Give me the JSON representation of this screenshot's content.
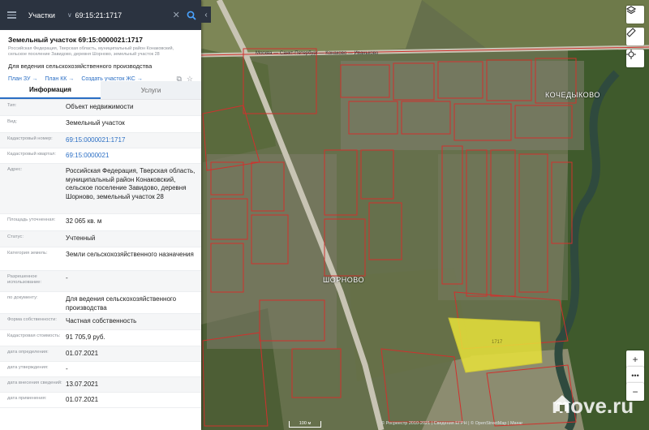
{
  "search": {
    "type_label": "Участки",
    "value": "69:15:21:1717"
  },
  "object": {
    "title": "Земельный участок 69:15:0000021:1717",
    "address_line": "Российская Федерация, Тверская область, муниципальный район Конаковский, сельское поселение Завидово, деревня Шорново, земельный участок 28",
    "purpose": "Для ведения сельскохозяйственного производства"
  },
  "links": {
    "plan_zu": "План ЗУ",
    "plan_kk": "План КК",
    "create_zhs": "Создать участок ЖС"
  },
  "tabs": {
    "info": "Информация",
    "services": "Услуги"
  },
  "properties": [
    {
      "key": "Тип:",
      "value": "Объект недвижимости"
    },
    {
      "key": "Вид:",
      "value": "Земельный участок"
    },
    {
      "key": "Кадастровый номер:",
      "value": "69:15:0000021:1717"
    },
    {
      "key": "Кадастровый квартал:",
      "value": "69:15:0000021"
    },
    {
      "key": "Адрес:",
      "value": "Российская Федерация, Тверская область, муниципальный район Конаковский, сельское поселение Завидово, деревня Шорново, земельный участок 28"
    },
    {
      "key": "Площадь уточненная:",
      "value": "32 065 кв. м"
    },
    {
      "key": "Статус:",
      "value": "Учтенный"
    },
    {
      "key": "Категория земель:",
      "value": "Земли сельскохозяйственного назначения"
    },
    {
      "key": "Разрешенное использование:",
      "value": "-"
    },
    {
      "key": "по документу:",
      "value": "Для ведения сельскохозяйственного производства"
    },
    {
      "key": "Форма собственности:",
      "value": "Частная собственность"
    },
    {
      "key": "Кадастровая стоимость:",
      "value": "91 705,9 руб."
    },
    {
      "key": "дата определения:",
      "value": "01.07.2021"
    },
    {
      "key": "дата утверждения:",
      "value": "-"
    },
    {
      "key": "дата внесения сведений:",
      "value": "13.07.2021"
    },
    {
      "key": "дата применения:",
      "value": "01.07.2021"
    }
  ],
  "map": {
    "village_1": "ШОРНОВО",
    "village_2": "КОЧЕДЫКОВО",
    "road_label": "Москва — Санкт-Петербург — Конаково — Иваньково",
    "parcel_label": "1717",
    "scale_label": "100 м",
    "attribution": "© Росреестр 2010-2021 | Сведения ЕГРН | © OpenStreetMap | Maxar",
    "watermark": "move.ru",
    "colors": {
      "parcel_highlight": "#e8e23a",
      "boundary": "#d0312d",
      "panel_header": "#2b3340",
      "link": "#2a6ec4"
    }
  }
}
